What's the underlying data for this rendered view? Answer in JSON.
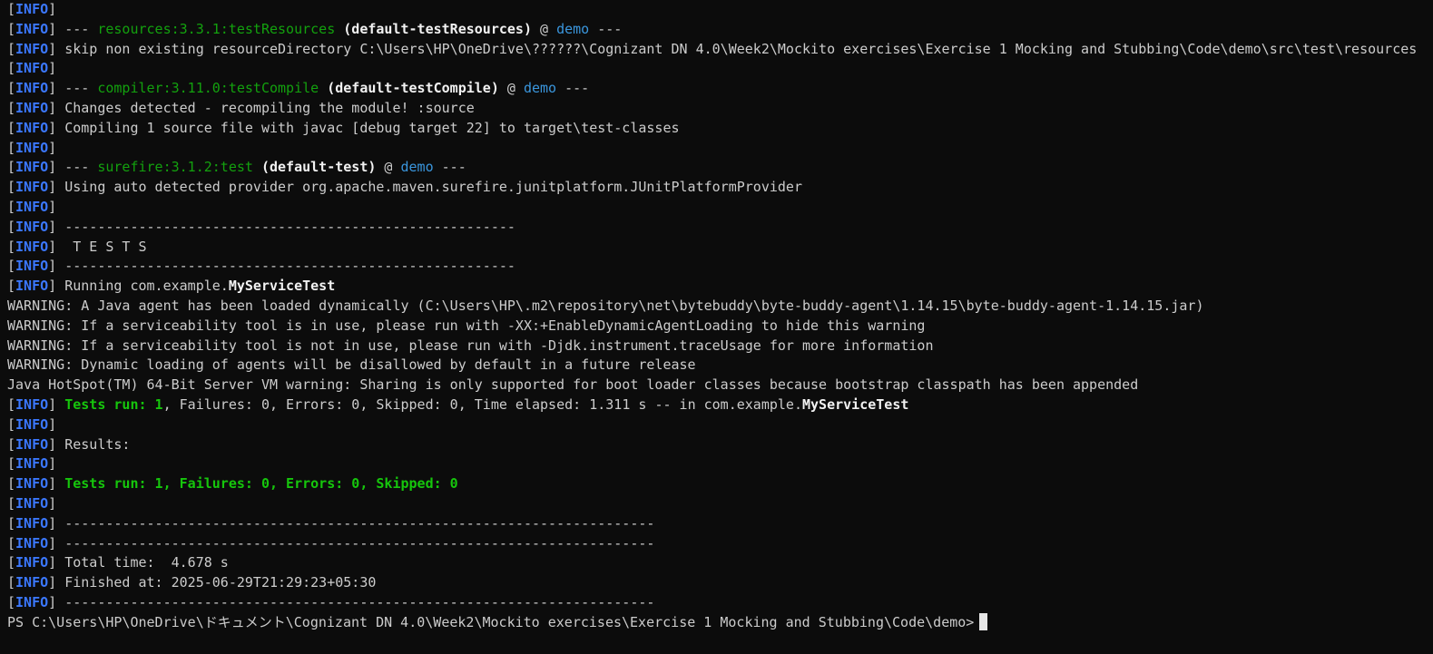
{
  "terminal": {
    "prompt_line": "PS C:\\Users\\HP\\OneDrive\\ドキュメント\\Cognizant DN 4.0\\Week2\\Mockito exercises\\Exercise 1 Mocking and Stubbing\\Code\\demo>",
    "lines": [
      {
        "prefix": true,
        "segs": []
      },
      {
        "prefix": true,
        "segs": [
          {
            "c": "",
            "t": "--- "
          },
          {
            "c": "green",
            "t": "resources:3.3.1:testResources"
          },
          {
            "c": "",
            "t": " "
          },
          {
            "c": "bold",
            "t": "(default-testResources)"
          },
          {
            "c": "",
            "t": " @ "
          },
          {
            "c": "blue",
            "t": "demo"
          },
          {
            "c": "",
            "t": " ---"
          }
        ]
      },
      {
        "prefix": true,
        "segs": [
          {
            "c": "",
            "t": "skip non existing resourceDirectory C:\\Users\\HP\\OneDrive\\??????\\Cognizant DN 4.0\\Week2\\Mockito exercises\\Exercise 1 Mocking and Stubbing\\Code\\demo\\src\\test\\resources"
          }
        ]
      },
      {
        "prefix": true,
        "segs": []
      },
      {
        "prefix": true,
        "segs": [
          {
            "c": "",
            "t": "--- "
          },
          {
            "c": "green",
            "t": "compiler:3.11.0:testCompile"
          },
          {
            "c": "",
            "t": " "
          },
          {
            "c": "bold",
            "t": "(default-testCompile)"
          },
          {
            "c": "",
            "t": " @ "
          },
          {
            "c": "blue",
            "t": "demo"
          },
          {
            "c": "",
            "t": " ---"
          }
        ]
      },
      {
        "prefix": true,
        "segs": [
          {
            "c": "",
            "t": "Changes detected - recompiling the module! :source"
          }
        ]
      },
      {
        "prefix": true,
        "segs": [
          {
            "c": "",
            "t": "Compiling 1 source file with javac [debug target 22] to target\\test-classes"
          }
        ]
      },
      {
        "prefix": true,
        "segs": []
      },
      {
        "prefix": true,
        "segs": [
          {
            "c": "",
            "t": "--- "
          },
          {
            "c": "green",
            "t": "surefire:3.1.2:test"
          },
          {
            "c": "",
            "t": " "
          },
          {
            "c": "bold",
            "t": "(default-test)"
          },
          {
            "c": "",
            "t": " @ "
          },
          {
            "c": "blue",
            "t": "demo"
          },
          {
            "c": "",
            "t": " ---"
          }
        ]
      },
      {
        "prefix": true,
        "segs": [
          {
            "c": "",
            "t": "Using auto detected provider org.apache.maven.surefire.junitplatform.JUnitPlatformProvider"
          }
        ]
      },
      {
        "prefix": true,
        "segs": []
      },
      {
        "prefix": true,
        "segs": [
          {
            "c": "",
            "t": "-------------------------------------------------------"
          }
        ]
      },
      {
        "prefix": true,
        "segs": [
          {
            "c": "",
            "t": " T E S T S"
          }
        ]
      },
      {
        "prefix": true,
        "segs": [
          {
            "c": "",
            "t": "-------------------------------------------------------"
          }
        ]
      },
      {
        "prefix": true,
        "segs": [
          {
            "c": "",
            "t": "Running com.example."
          },
          {
            "c": "bold",
            "t": "MyServiceTest"
          }
        ]
      },
      {
        "prefix": false,
        "segs": [
          {
            "c": "",
            "t": "WARNING: A Java agent has been loaded dynamically (C:\\Users\\HP\\.m2\\repository\\net\\bytebuddy\\byte-buddy-agent\\1.14.15\\byte-buddy-agent-1.14.15.jar)"
          }
        ]
      },
      {
        "prefix": false,
        "segs": [
          {
            "c": "",
            "t": "WARNING: If a serviceability tool is in use, please run with -XX:+EnableDynamicAgentLoading to hide this warning"
          }
        ]
      },
      {
        "prefix": false,
        "segs": [
          {
            "c": "",
            "t": "WARNING: If a serviceability tool is not in use, please run with -Djdk.instrument.traceUsage for more information"
          }
        ]
      },
      {
        "prefix": false,
        "segs": [
          {
            "c": "",
            "t": "WARNING: Dynamic loading of agents will be disallowed by default in a future release"
          }
        ]
      },
      {
        "prefix": false,
        "segs": [
          {
            "c": "",
            "t": "Java HotSpot(TM) 64-Bit Server VM warning: Sharing is only supported for boot loader classes because bootstrap classpath has been appended"
          }
        ]
      },
      {
        "prefix": true,
        "segs": [
          {
            "c": "bgreen",
            "t": "Tests run: 1"
          },
          {
            "c": "",
            "t": ", Failures: 0, Errors: 0, Skipped: 0, Time elapsed: 1.311 s -- in com.example."
          },
          {
            "c": "bold",
            "t": "MyServiceTest"
          }
        ]
      },
      {
        "prefix": true,
        "segs": []
      },
      {
        "prefix": true,
        "segs": [
          {
            "c": "",
            "t": "Results:"
          }
        ]
      },
      {
        "prefix": true,
        "segs": []
      },
      {
        "prefix": true,
        "segs": [
          {
            "c": "bgreen",
            "t": "Tests run: 1, Failures: 0, Errors: 0, Skipped: 0"
          }
        ]
      },
      {
        "prefix": true,
        "segs": []
      },
      {
        "prefix": true,
        "segs": [
          {
            "c": "",
            "t": "------------------------------------------------------------------------"
          }
        ]
      },
      {
        "prefix": true,
        "segs": [
          {
            "c": "",
            "t": "------------------------------------------------------------------------"
          }
        ]
      },
      {
        "prefix": true,
        "segs": [
          {
            "c": "",
            "t": "Total time:  4.678 s"
          }
        ]
      },
      {
        "prefix": true,
        "segs": [
          {
            "c": "",
            "t": "Finished at: 2025-06-29T21:29:23+05:30"
          }
        ]
      },
      {
        "prefix": true,
        "segs": [
          {
            "c": "",
            "t": "------------------------------------------------------------------------"
          }
        ]
      }
    ]
  },
  "prefix_text": {
    "open": "[",
    "label": "INFO",
    "close": "]"
  },
  "colors": {
    "background": "#0c0c0c",
    "foreground": "#cccccc",
    "info": "#3b78ff",
    "plugin": "#13a10e",
    "project": "#3a96dd",
    "success": "#16c60c"
  }
}
